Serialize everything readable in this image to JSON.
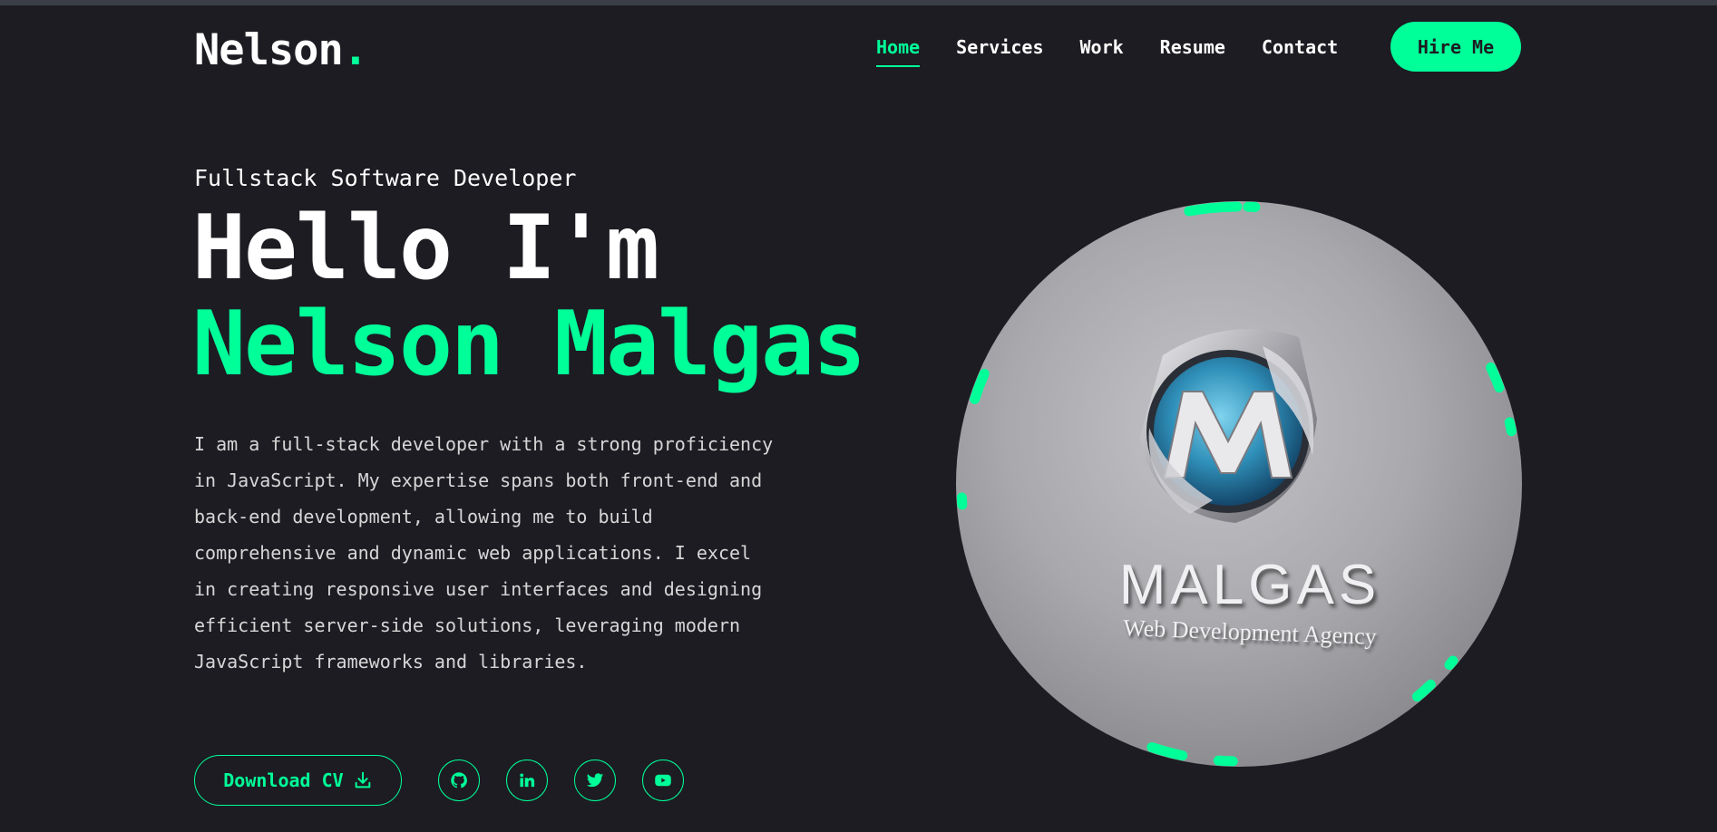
{
  "header": {
    "logo_text": "Nelson",
    "logo_dot": ".",
    "nav": [
      {
        "label": "Home",
        "active": true
      },
      {
        "label": "Services",
        "active": false
      },
      {
        "label": "Work",
        "active": false
      },
      {
        "label": "Resume",
        "active": false
      },
      {
        "label": "Contact",
        "active": false
      }
    ],
    "hire_label": "Hire Me"
  },
  "hero": {
    "subtitle": "Fullstack Software Developer",
    "greeting": "Hello I'm",
    "name": "Nelson Malgas",
    "bio": "I am a full-stack developer with a strong proficiency in JavaScript. My expertise spans both front-end and back-end development, allowing me to build comprehensive and dynamic web applications. I excel in creating responsive user interfaces and designing efficient server-side solutions, leveraging modern JavaScript frameworks and libraries.",
    "download_label": "Download CV",
    "socials": [
      {
        "icon": "github-icon"
      },
      {
        "icon": "linkedin-icon"
      },
      {
        "icon": "twitter-icon"
      },
      {
        "icon": "youtube-icon"
      }
    ]
  },
  "photo": {
    "brand_name": "MALGAS",
    "brand_tagline": "Web Development Agency"
  },
  "colors": {
    "accent": "#00ff99",
    "background": "#1c1c22",
    "text": "#ffffff"
  }
}
